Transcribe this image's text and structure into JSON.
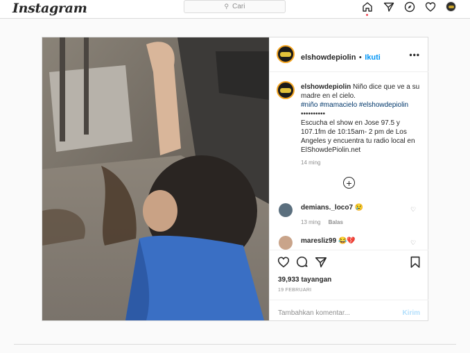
{
  "app": {
    "logo": "Instagram"
  },
  "search": {
    "placeholder": "Cari"
  },
  "nav": {
    "icons": [
      "home-icon",
      "direct-icon",
      "explore-icon",
      "activity-icon",
      "profile-avatar"
    ],
    "accent": "#ed4956"
  },
  "post": {
    "username": "elshowdepiolin",
    "follow_label": "Ikuti",
    "bullet": "•",
    "more": "•••",
    "caption_user": "elshowdepiolin",
    "caption_text": "Niño dice que ve a su madre en el cielo.",
    "caption_tags": "#niño #mamacielo #elshowdepiolin",
    "caption_dots": "••••••••••",
    "caption_body": "Escucha el show en Jose 97.5 y 107.1fm de 10:15am- 2 pm de Los Angeles y encuentra tu radio local en ElShowdePiolin.net",
    "caption_time": "14 ming",
    "load_more_icon": "plus-circle-icon",
    "comments": [
      {
        "user": "demians._loco7",
        "emoji": "😢",
        "time": "13 ming",
        "reply": "Balas"
      },
      {
        "user": "maresliz99",
        "emoji": "😂💔"
      }
    ],
    "views": "39,933 tayangan",
    "date": "19 FEBRUARI",
    "comment_placeholder": "Tambahkan komentar...",
    "post_button": "Kirim",
    "link_color": "#0095f6",
    "tag_color": "#00376b"
  }
}
